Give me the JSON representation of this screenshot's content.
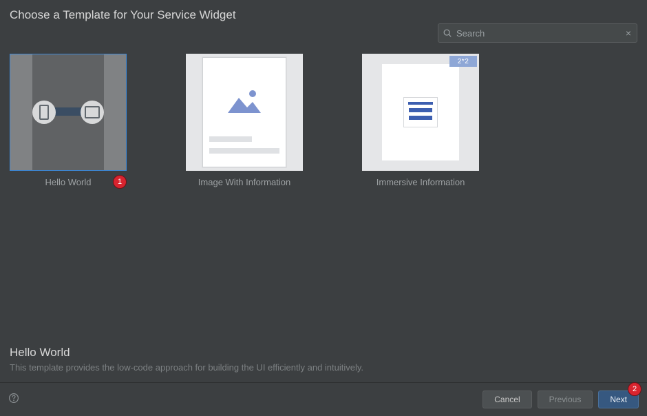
{
  "header": {
    "title": "Choose a Template for Your Service Widget"
  },
  "search": {
    "placeholder": "Search",
    "value": ""
  },
  "templates": [
    {
      "label": "Hello World",
      "selected": true
    },
    {
      "label": "Image With Information",
      "selected": false
    },
    {
      "label": "Immersive Information",
      "selected": false,
      "badge": "2*2"
    }
  ],
  "details": {
    "title": "Hello World",
    "description": "This template provides the low-code approach for building the UI efficiently and intuitively."
  },
  "footer": {
    "cancel": "Cancel",
    "previous": "Previous",
    "next": "Next"
  },
  "annotations": {
    "step1": "1",
    "step2": "2"
  }
}
